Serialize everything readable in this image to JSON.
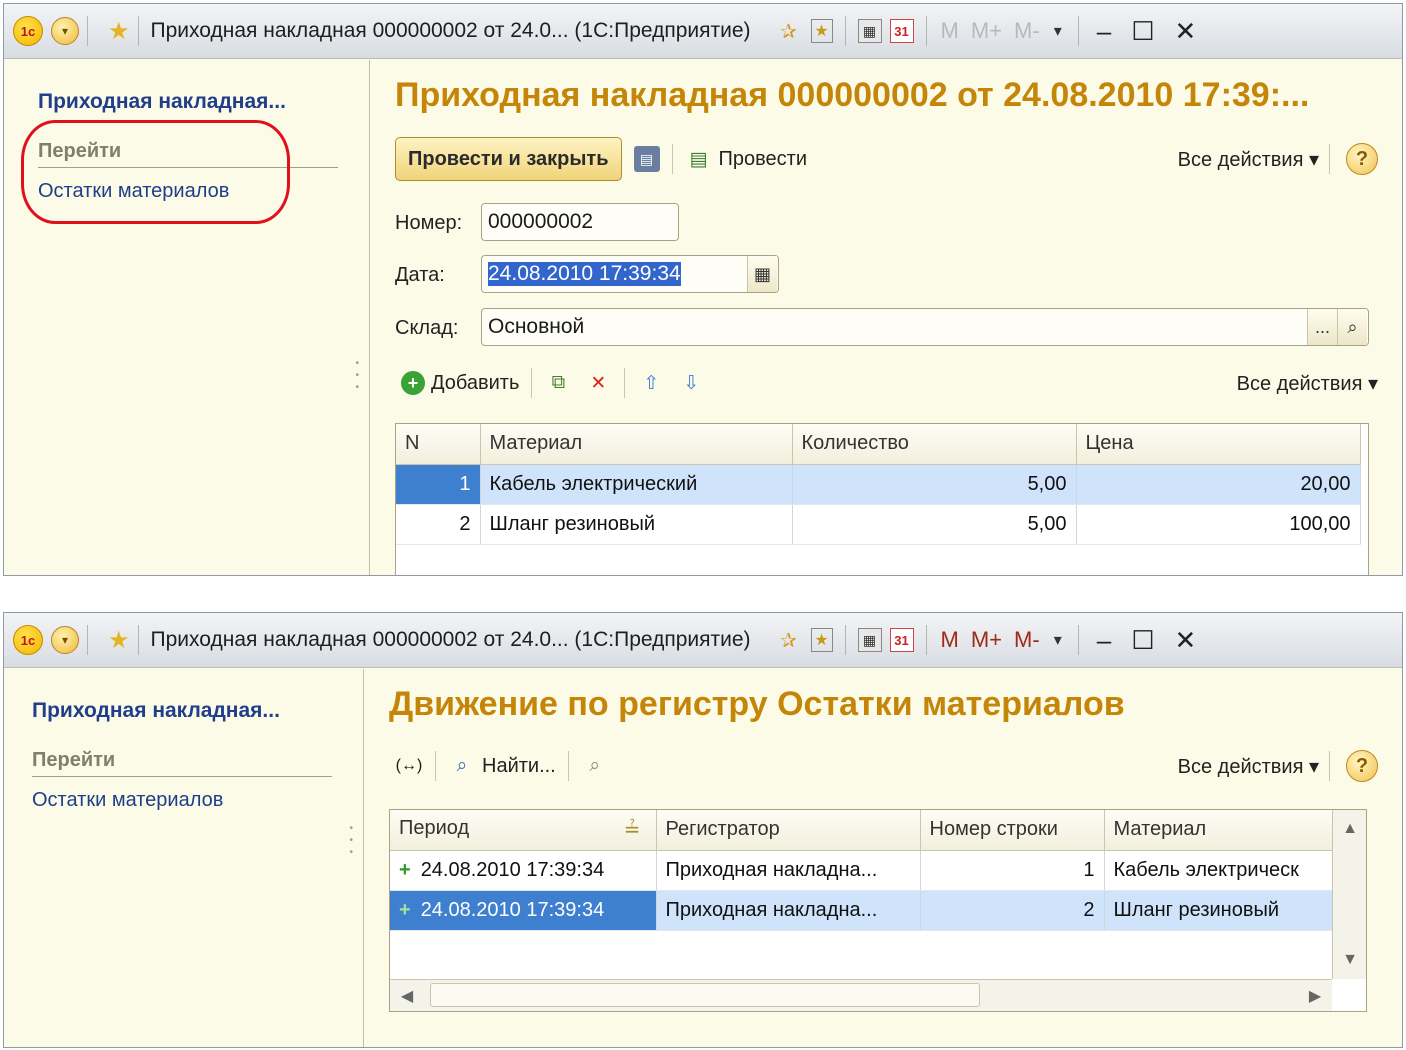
{
  "window1": {
    "title": "Приходная накладная 000000002 от 24.0...  (1С:Предприятие)",
    "m_buttons": [
      "M",
      "M+",
      "M-"
    ],
    "sidebar": {
      "title": "Приходная накладная...",
      "section": "Перейти",
      "link": "Остатки материалов"
    },
    "page_title": "Приходная накладная 000000002 от 24.08.2010 17:39:...",
    "commands": {
      "post_and_close": "Провести и закрыть",
      "post": "Провести",
      "all_actions": "Все действия ▾",
      "help": "?"
    },
    "fields": {
      "number_label": "Номер:",
      "number_value": "000000002",
      "date_label": "Дата:",
      "date_value": "24.08.2010 17:39:34",
      "warehouse_label": "Склад:",
      "warehouse_value": "Основной",
      "warehouse_choice": "...",
      "warehouse_open": "Q"
    },
    "table_commands": {
      "add": "Добавить",
      "all_actions": "Все действия ▾"
    },
    "table": {
      "columns": [
        "N",
        "Материал",
        "Количество",
        "Цена"
      ],
      "rows": [
        {
          "n": "1",
          "material": "Кабель электрический",
          "qty": "5,00",
          "price": "20,00"
        },
        {
          "n": "2",
          "material": "Шланг резиновый",
          "qty": "5,00",
          "price": "100,00"
        }
      ]
    }
  },
  "window2": {
    "title": "Приходная накладная 000000002 от 24.0...  (1С:Предприятие)",
    "m_buttons": [
      "M",
      "M+",
      "M-"
    ],
    "sidebar": {
      "title": "Приходная накладная...",
      "section": "Перейти",
      "link": "Остатки материалов"
    },
    "page_title": "Движение по регистру Остатки материалов",
    "commands": {
      "find": "Найти...",
      "all_actions": "Все действия ▾",
      "help": "?"
    },
    "table": {
      "columns": [
        "Период",
        "Регистратор",
        "Номер строки",
        "Материал"
      ],
      "rows": [
        {
          "period": "24.08.2010 17:39:34",
          "registrar": "Приходная накладна...",
          "line": "1",
          "material": "Кабель электрическ"
        },
        {
          "period": "24.08.2010 17:39:34",
          "registrar": "Приходная накладна...",
          "line": "2",
          "material": "Шланг резиновый"
        }
      ]
    }
  },
  "colors": {
    "accent_title": "#c48508",
    "link": "#1f3e88",
    "selection": "#3e7fd0",
    "highlight_oval": "#e0101c"
  },
  "icons": [
    "1c-logo-icon",
    "menu-dropdown-icon",
    "favorites-star-icon",
    "add-favorite-icon",
    "bookmark-icon",
    "calculator-icon",
    "calendar-icon",
    "save-icon",
    "post-icon",
    "add-icon",
    "copy-icon",
    "delete-icon",
    "move-up-icon",
    "move-down-icon",
    "find-icon",
    "cancel-search-icon",
    "help-icon"
  ]
}
